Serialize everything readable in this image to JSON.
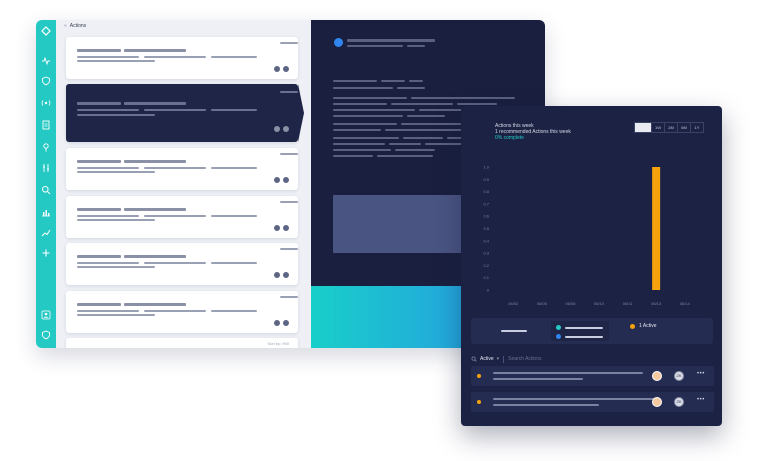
{
  "list_panel": {
    "breadcrumb": "Actions",
    "footnote": "Sort by: Hi/li"
  },
  "widget": {
    "title_line1": "Actions this week",
    "title_line2": "1 recommended Actions this week",
    "progress": "0% complete",
    "ranges": [
      "",
      "1W",
      "2M",
      "6M",
      "1Y"
    ],
    "legend_label": "1 Active",
    "filter_selected": "Active",
    "search_placeholder": "Search Actions",
    "row_avatar_initials": "ZK"
  },
  "colors": {
    "accent_teal": "#25c9c4",
    "bar_orange": "#f5a20c",
    "navy": "#1c2244",
    "blue": "#2f86f0"
  },
  "chart_data": {
    "type": "bar",
    "categories": [
      "06/02",
      "06/05",
      "06/08",
      "06/10",
      "06/11",
      "06/13",
      "06/14"
    ],
    "values": [
      0,
      0,
      0,
      0,
      0,
      1,
      0
    ],
    "y_ticks": [
      "0",
      "0.1",
      "0.2",
      "0.3",
      "0.4",
      "0.5",
      "0.6",
      "0.7",
      "0.8",
      "0.9",
      "1.0"
    ],
    "ylim": [
      0,
      1
    ],
    "grid": false,
    "legend": "bottom"
  }
}
